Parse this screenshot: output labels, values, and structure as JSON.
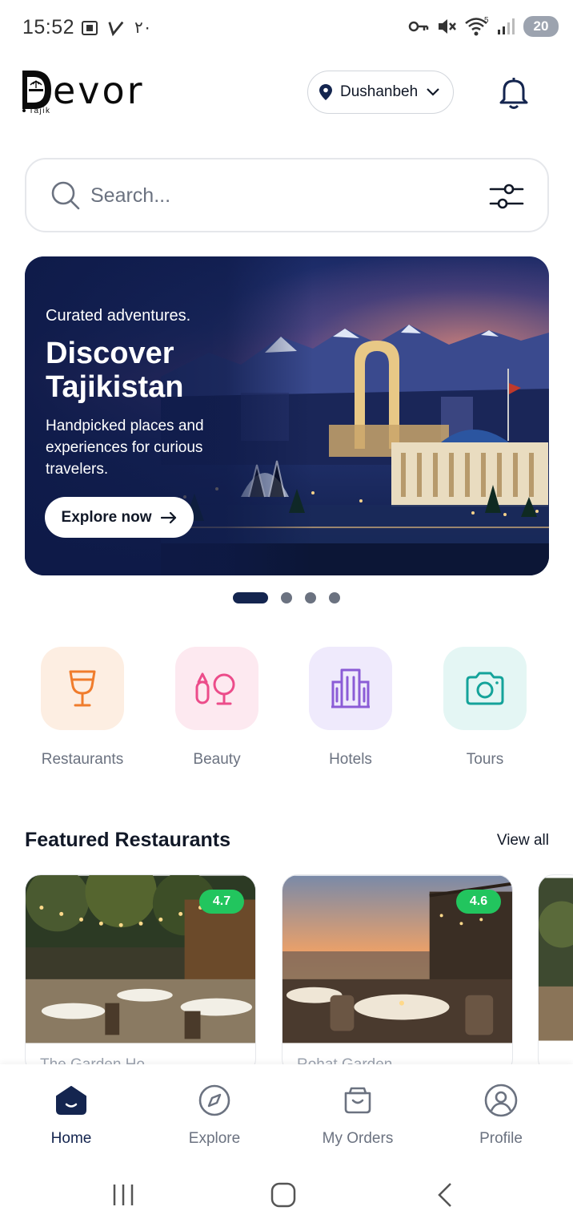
{
  "status_bar": {
    "time": "15:52",
    "arabic_indicator": "٢٠",
    "battery": "20",
    "network_badge": "5"
  },
  "header": {
    "logo_text": "evor",
    "logo_letter": "D",
    "logo_sub": "Tajik",
    "location": "Dushanbeh",
    "location_icon": "map-pin-icon",
    "bell_icon": "bell-icon"
  },
  "search": {
    "placeholder": "Search..."
  },
  "banner": {
    "kicker": "Curated adventures.",
    "title": "Discover Tajikistan",
    "text": "Handpicked places and experiences for curious travelers.",
    "button_label": "Explore now",
    "slides": 4,
    "active_slide": 1
  },
  "categories": [
    {
      "label": "Restaurants",
      "icon": "wine-glass-icon",
      "bg": "#fdeee2",
      "color": "#f07c2c"
    },
    {
      "label": "Beauty",
      "icon": "beauty-icon",
      "bg": "#fde9f0",
      "color": "#ec4c8a"
    },
    {
      "label": "Hotels",
      "icon": "building-icon",
      "bg": "#efeafc",
      "color": "#8b5cd6"
    },
    {
      "label": "Tours",
      "icon": "camera-icon",
      "bg": "#e4f6f4",
      "color": "#14a39a"
    }
  ],
  "featured": {
    "title": "Featured Restaurants",
    "view_all": "View all",
    "cards": [
      {
        "rating": "4.7",
        "name": "The Garden Ho..."
      },
      {
        "rating": "4.6",
        "name": "Rohat Garden"
      }
    ]
  },
  "nav": {
    "items": [
      {
        "label": "Home",
        "icon": "home-icon"
      },
      {
        "label": "Explore",
        "icon": "compass-icon"
      },
      {
        "label": "My Orders",
        "icon": "bag-icon"
      },
      {
        "label": "Profile",
        "icon": "user-icon"
      }
    ]
  },
  "colors": {
    "brand": "#14254f",
    "rating": "#22c55e"
  }
}
